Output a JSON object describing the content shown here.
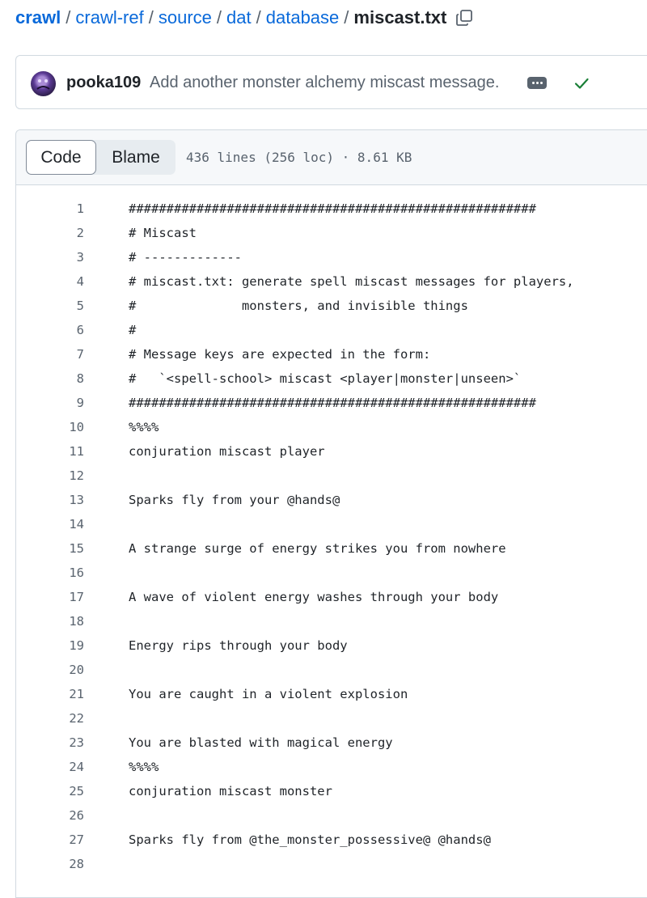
{
  "breadcrumb": {
    "items": [
      "crawl",
      "crawl-ref",
      "source",
      "dat",
      "database"
    ],
    "separator": "/",
    "current": "miscast.txt"
  },
  "commit": {
    "author": "pooka109",
    "message": "Add another monster alchemy miscast message."
  },
  "file": {
    "tabs": [
      "Code",
      "Blame"
    ],
    "info": "436 lines (256 loc) · 8.61 KB"
  },
  "lines": [
    {
      "n": "1",
      "text": "######################################################"
    },
    {
      "n": "2",
      "text": "# Miscast"
    },
    {
      "n": "3",
      "text": "# -------------"
    },
    {
      "n": "4",
      "text": "# miscast.txt: generate spell miscast messages for players,"
    },
    {
      "n": "5",
      "text": "#              monsters, and invisible things"
    },
    {
      "n": "6",
      "text": "#"
    },
    {
      "n": "7",
      "text": "# Message keys are expected in the form:"
    },
    {
      "n": "8",
      "text": "#   `<spell-school> miscast <player|monster|unseen>`"
    },
    {
      "n": "9",
      "text": "######################################################"
    },
    {
      "n": "10",
      "text": "%%%%"
    },
    {
      "n": "11",
      "text": "conjuration miscast player"
    },
    {
      "n": "12",
      "text": ""
    },
    {
      "n": "13",
      "text": "Sparks fly from your @hands@"
    },
    {
      "n": "14",
      "text": ""
    },
    {
      "n": "15",
      "text": "A strange surge of energy strikes you from nowhere"
    },
    {
      "n": "16",
      "text": ""
    },
    {
      "n": "17",
      "text": "A wave of violent energy washes through your body"
    },
    {
      "n": "18",
      "text": ""
    },
    {
      "n": "19",
      "text": "Energy rips through your body"
    },
    {
      "n": "20",
      "text": ""
    },
    {
      "n": "21",
      "text": "You are caught in a violent explosion"
    },
    {
      "n": "22",
      "text": ""
    },
    {
      "n": "23",
      "text": "You are blasted with magical energy"
    },
    {
      "n": "24",
      "text": "%%%%"
    },
    {
      "n": "25",
      "text": "conjuration miscast monster"
    },
    {
      "n": "26",
      "text": ""
    },
    {
      "n": "27",
      "text": "Sparks fly from @the_monster_possessive@ @hands@"
    },
    {
      "n": "28",
      "text": ""
    }
  ]
}
